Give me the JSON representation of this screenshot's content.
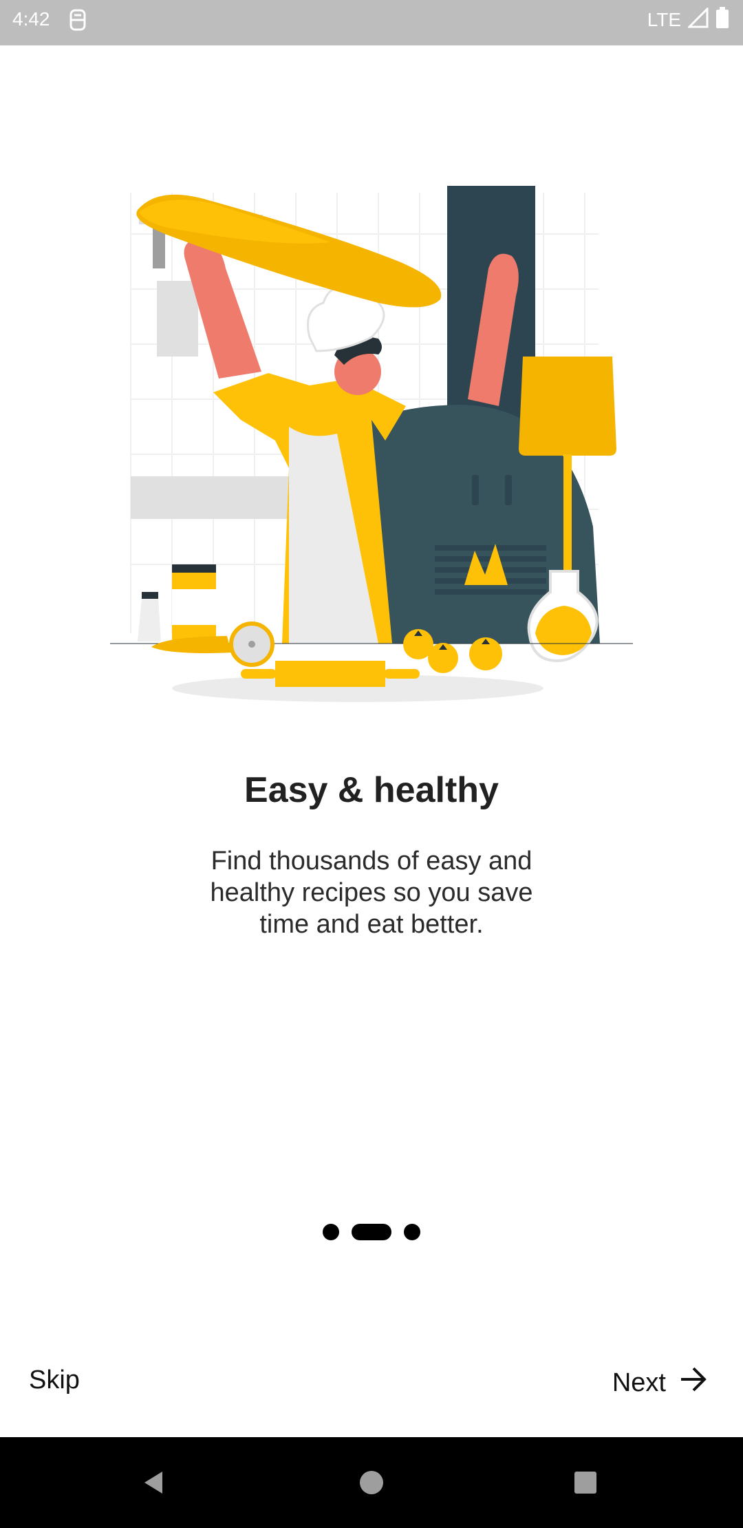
{
  "status_bar": {
    "time": "4:42",
    "network": "LTE",
    "icons": [
      "app-notification-icon",
      "signal-icon",
      "battery-icon"
    ]
  },
  "onboarding": {
    "title": "Easy & healthy",
    "description": "Find thousands of easy and healthy recipes so you save time and eat better.",
    "illustration": "chef-tossing-pizza-illustration",
    "page_count": 3,
    "current_page": 2
  },
  "actions": {
    "skip_label": "Skip",
    "next_label": "Next",
    "next_icon": "arrow-right-icon"
  },
  "nav_bar": {
    "icons": [
      "back-icon",
      "home-icon",
      "recents-icon"
    ]
  },
  "colors": {
    "accent_yellow": "#FFC107",
    "skin": "#EE7B6B",
    "oven": "#37535C"
  }
}
